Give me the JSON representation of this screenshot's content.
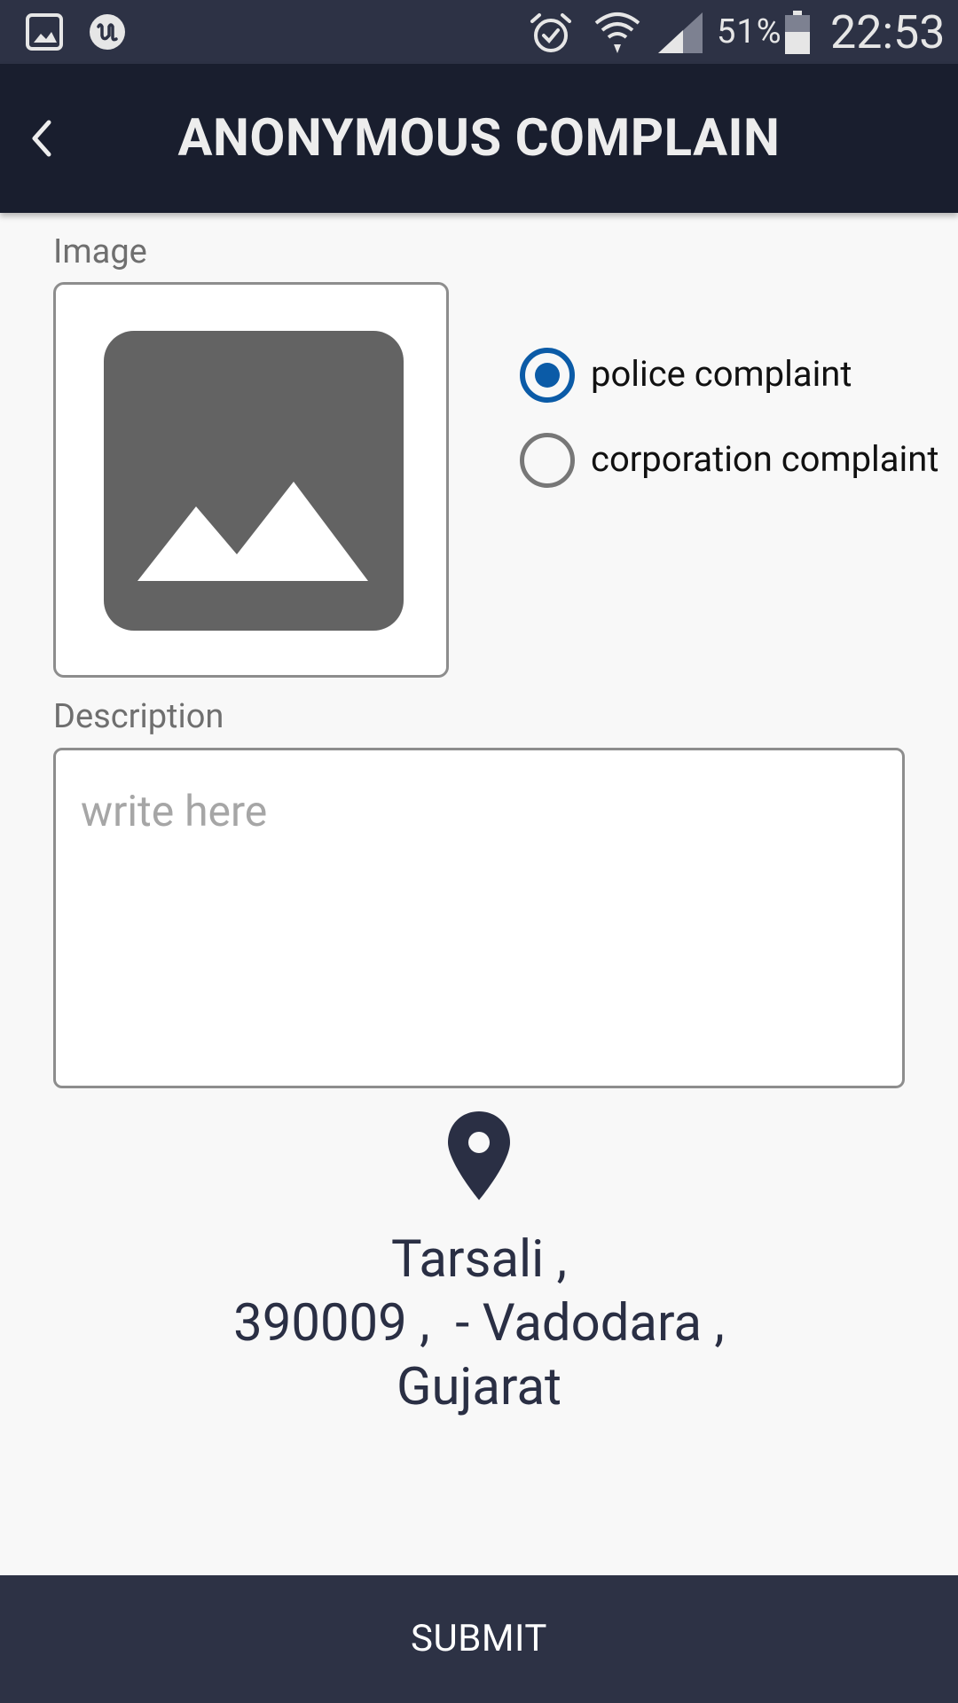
{
  "status_bar": {
    "battery_percent": "51%",
    "time": "22:53",
    "icons": [
      "gallery-icon",
      "app-u-icon",
      "alarm-icon",
      "wifi-icon",
      "signal-icon",
      "battery-icon"
    ]
  },
  "app_bar": {
    "title": "ANONYMOUS COMPLAIN",
    "back_icon": "chevron-left-icon"
  },
  "form": {
    "image_label": "Image",
    "image_placeholder_icon": "image-placeholder-icon",
    "complaint_types": [
      {
        "label": "police complaint",
        "selected": true
      },
      {
        "label": "corporation complaint",
        "selected": false
      }
    ],
    "description_label": "Description",
    "description_placeholder": "write here",
    "description_value": ""
  },
  "location": {
    "icon": "location-pin-icon",
    "address_lines": [
      "Tarsali ,",
      "390009 ,  - Vadodara ,",
      "Gujarat"
    ]
  },
  "submit": {
    "label": "SUBMIT"
  },
  "colors": {
    "status_bar": "#2d3245",
    "app_bar": "#191e2e",
    "accent": "#0b5ba7",
    "address_text": "#2a2f44",
    "submit_bg": "#2d3245"
  }
}
